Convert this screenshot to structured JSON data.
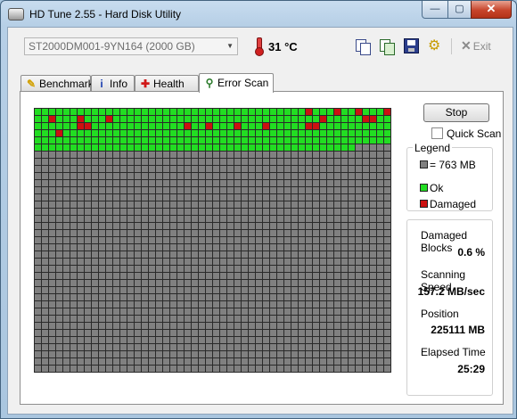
{
  "window": {
    "title": "HD Tune 2.55 - Hard Disk Utility",
    "minimize_glyph": "—",
    "maximize_glyph": "▢",
    "close_glyph": "✕"
  },
  "toolbar": {
    "drive": "ST2000DM001-9YN164 (2000 GB)",
    "temperature": "31 °C",
    "exit_label": "Exit",
    "icons": [
      "copy-text-icon",
      "copy-screenshot-icon",
      "save-icon",
      "options-icon",
      "exit-icon"
    ]
  },
  "tabs": [
    {
      "label": "Benchmark",
      "icon": "benchmark-icon",
      "active": false
    },
    {
      "label": "Info",
      "icon": "info-icon",
      "active": false
    },
    {
      "label": "Health",
      "icon": "health-icon",
      "active": false
    },
    {
      "label": "Error Scan",
      "icon": "error-scan-icon",
      "active": true
    }
  ],
  "scan": {
    "stop_label": "Stop",
    "quick_scan_label": "Quick Scan",
    "quick_scan_checked": false,
    "legend": {
      "title": "Legend",
      "items": [
        {
          "label": "= 763 MB",
          "color": "#808080"
        },
        {
          "label": "Ok",
          "color": "#22dd22"
        },
        {
          "label": "Damaged",
          "color": "#cc1111"
        }
      ]
    },
    "stats": {
      "damaged_blocks_label": "Damaged Blocks",
      "damaged_blocks_value": "0.6 %",
      "scanning_speed_label": "Scanning Speed",
      "scanning_speed_value": "157.2 MB/sec",
      "position_label": "Position",
      "position_value": "225111 MB",
      "elapsed_label": "Elapsed Time",
      "elapsed_value": "25:29"
    },
    "block_map": {
      "columns": 50,
      "rows": 37,
      "scanned_blocks": 295,
      "colors": {
        "unscanned": "#808080",
        "ok": "#22dd22",
        "damaged": "#cc1111"
      },
      "damaged_cells": [
        [
          0,
          38
        ],
        [
          0,
          42
        ],
        [
          0,
          45
        ],
        [
          0,
          49
        ],
        [
          1,
          2
        ],
        [
          1,
          6
        ],
        [
          1,
          10
        ],
        [
          1,
          40
        ],
        [
          1,
          46
        ],
        [
          1,
          47
        ],
        [
          2,
          6
        ],
        [
          2,
          7
        ],
        [
          2,
          21
        ],
        [
          2,
          24
        ],
        [
          2,
          28
        ],
        [
          2,
          32
        ],
        [
          2,
          38
        ],
        [
          2,
          39
        ],
        [
          3,
          3
        ]
      ]
    }
  }
}
